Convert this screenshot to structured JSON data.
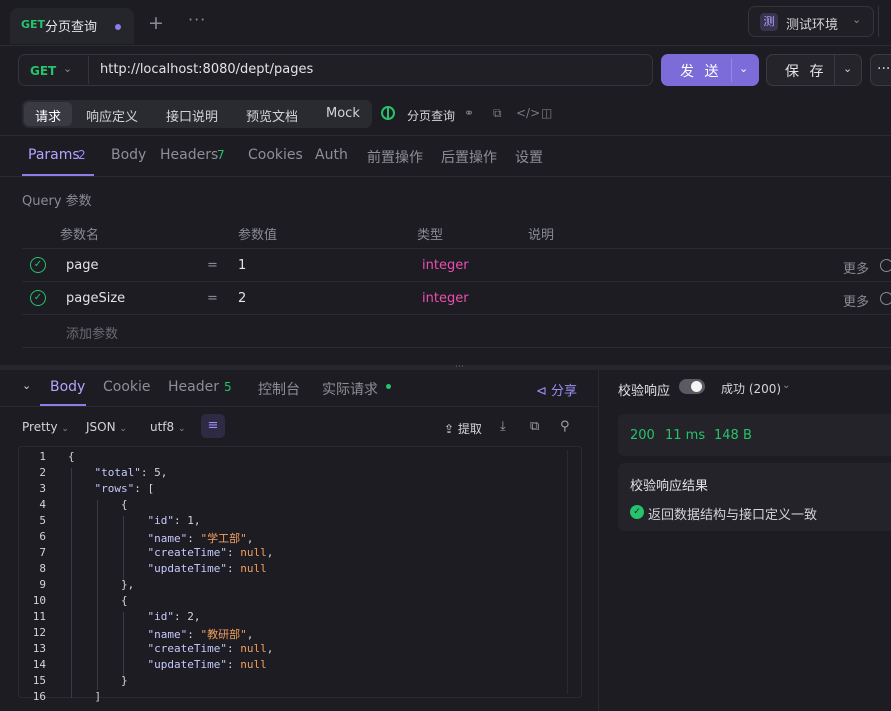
{
  "tabs": {
    "active": {
      "method": "GET",
      "title": "分页查询"
    },
    "add": "+",
    "more": "···"
  },
  "env": {
    "icon_char": "测",
    "label": "测试环境"
  },
  "request": {
    "method": "GET",
    "url": "http://localhost:8080/dept/pages",
    "send_label": "发 送",
    "save_label": "保 存",
    "more": "···"
  },
  "subnav": {
    "items": [
      "请求",
      "响应定义",
      "接口说明",
      "预览文档",
      "Mock"
    ],
    "api_name": "分页查询"
  },
  "param_tabs": {
    "items": [
      "Params",
      "Body",
      "Headers",
      "Cookies",
      "Auth",
      "前置操作",
      "后置操作",
      "设置"
    ],
    "params_count": "2",
    "headers_count": "7"
  },
  "query": {
    "section_label": "Query 参数",
    "headers": [
      "参数名",
      "参数值",
      "类型",
      "说明"
    ],
    "rows": [
      {
        "name": "page",
        "eq": "=",
        "value": "1",
        "type": "integer",
        "more": "更多"
      },
      {
        "name": "pageSize",
        "eq": "=",
        "value": "2",
        "type": "integer",
        "more": "更多"
      }
    ],
    "add_label": "添加参数"
  },
  "response": {
    "tabs": [
      "Body",
      "Cookie",
      "Header",
      "控制台",
      "实际请求"
    ],
    "header_count": "5",
    "share": "分享",
    "format": [
      "Pretty",
      "JSON",
      "utf8"
    ],
    "extract": "提取",
    "line_numbers": [
      "1",
      "2",
      "3",
      "4",
      "5",
      "6",
      "7",
      "8",
      "9",
      "10",
      "11",
      "12",
      "13",
      "14",
      "15",
      "16"
    ]
  },
  "verify": {
    "label": "校验响应",
    "status": "成功 (200)",
    "metrics": [
      "200",
      "11 ms",
      "148 B"
    ],
    "result_title": "校验响应结果",
    "result_text": "返回数据结构与接口定义一致"
  },
  "colors": {
    "accent": "#8b7ee6",
    "success": "#27c26c",
    "type": "#ec4fb0",
    "string": "#f0a060"
  }
}
